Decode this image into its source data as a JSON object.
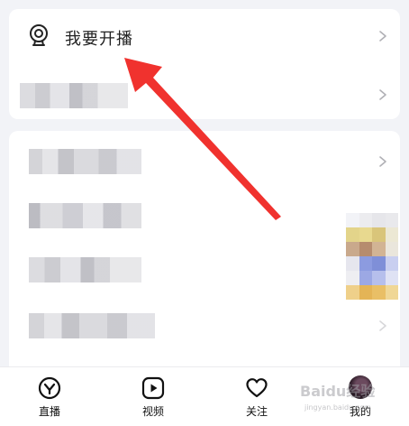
{
  "menu": {
    "live_label": "我要开播"
  },
  "tabbar": {
    "live": "直播",
    "video": "视频",
    "follow": "关注",
    "mine": "我的"
  },
  "watermark": {
    "text": "Baidu经验",
    "sub": "jingyan.baidu.com"
  },
  "colors": {
    "arrow": "#f0322e",
    "background": "#f2f3f7",
    "card": "#ffffff"
  }
}
